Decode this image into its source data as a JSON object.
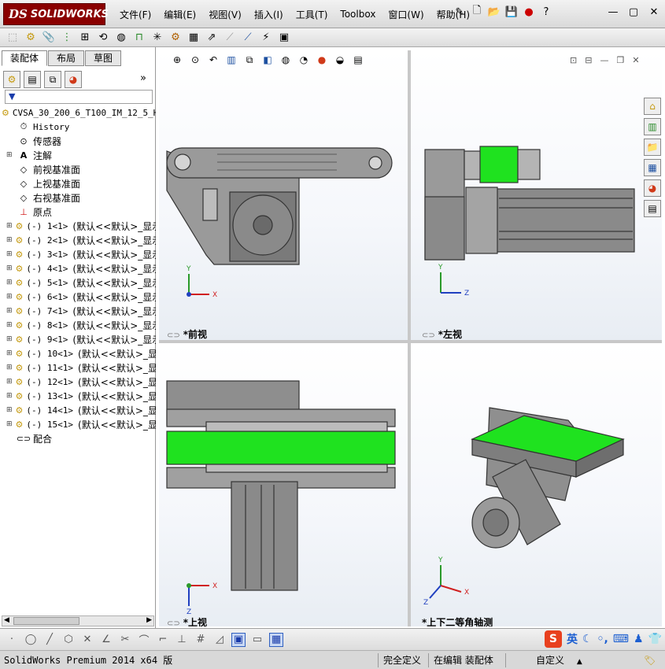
{
  "app": {
    "logo_ds": "DS",
    "logo_text": "SOLIDWORKS"
  },
  "menu": [
    "文件(F)",
    "编辑(E)",
    "视图(V)",
    "插入(I)",
    "工具(T)",
    "Toolbox",
    "窗口(W)",
    "帮助(H)"
  ],
  "panel": {
    "tabs": [
      "装配体",
      "布局",
      "草图"
    ],
    "filter": "▼",
    "root": "CVSA_30_200_6_T100_IM_12_5_H",
    "fixed_items": [
      "History",
      "传感器",
      "注解",
      "前视基准面",
      "上视基准面",
      "右视基准面",
      "原点"
    ],
    "parts": [
      {
        "prefix": "(-) 1<1>",
        "config": "(默认<<默认>_显示"
      },
      {
        "prefix": "(-) 2<1>",
        "config": "(默认<<默认>_显示"
      },
      {
        "prefix": "(-) 3<1>",
        "config": "(默认<<默认>_显示"
      },
      {
        "prefix": "(-) 4<1>",
        "config": "(默认<<默认>_显示"
      },
      {
        "prefix": "(-) 5<1>",
        "config": "(默认<<默认>_显示"
      },
      {
        "prefix": "(-) 6<1>",
        "config": "(默认<<默认>_显示"
      },
      {
        "prefix": "(-) 7<1>",
        "config": "(默认<<默认>_显示"
      },
      {
        "prefix": "(-) 8<1>",
        "config": "(默认<<默认>_显示"
      },
      {
        "prefix": "(-) 9<1>",
        "config": "(默认<<默认>_显示"
      },
      {
        "prefix": "(-) 10<1>",
        "config": "(默认<<默认>_显示"
      },
      {
        "prefix": "(-) 11<1>",
        "config": "(默认<<默认>_显示"
      },
      {
        "prefix": "(-) 12<1>",
        "config": "(默认<<默认>_显示"
      },
      {
        "prefix": "(-) 13<1>",
        "config": "(默认<<默认>_显示"
      },
      {
        "prefix": "(-) 14<1>",
        "config": "(默认<<默认>_显示"
      },
      {
        "prefix": "(-) 15<1>",
        "config": "(默认<<默认>_显示"
      }
    ],
    "mates": "配合"
  },
  "viewports": {
    "front": "*前视",
    "left": "*左视",
    "top": "*上视",
    "iso": "*上下二等角轴测"
  },
  "axes": {
    "x": "X",
    "y": "Y",
    "z": "Z"
  },
  "status": {
    "product": "SolidWorks Premium 2014 x64 版",
    "defined": "完全定义",
    "editing": "在编辑 装配体",
    "units": "自定义",
    "units_arrow": "▲"
  },
  "ime": {
    "logo": "S",
    "lang": "英"
  },
  "colors": {
    "belt": "#1fe21f",
    "accent": "#8a0000",
    "part": "#8f8f8f"
  }
}
